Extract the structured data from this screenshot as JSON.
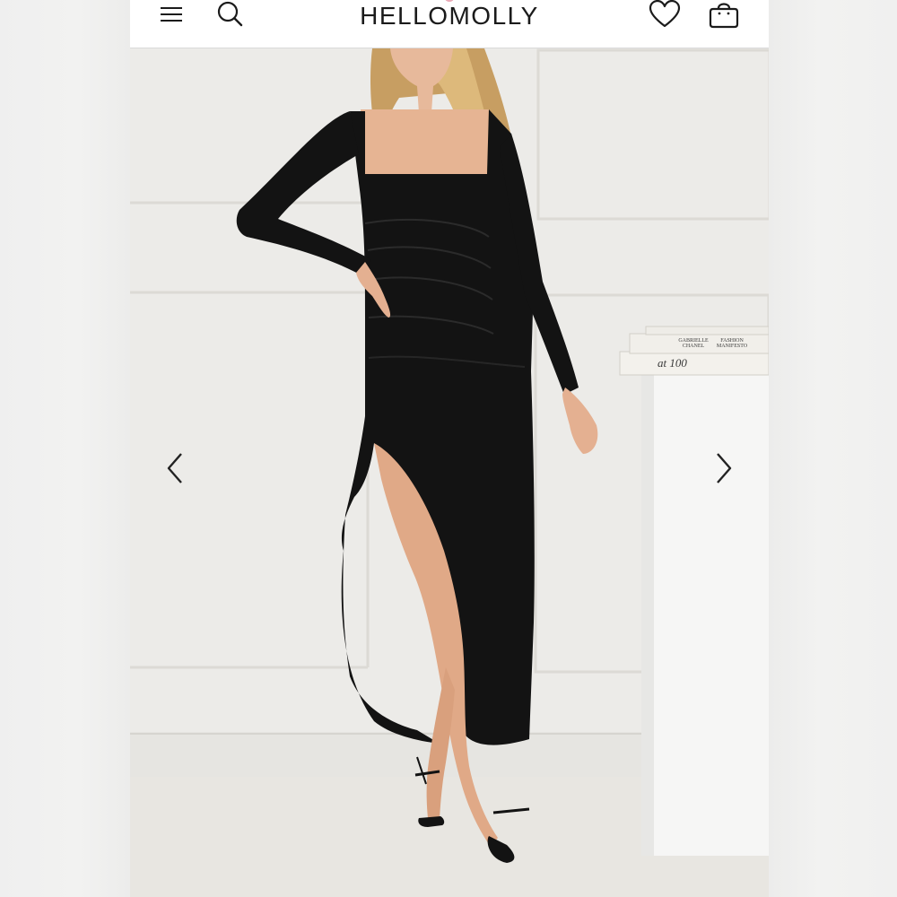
{
  "header": {
    "brand": "HELLOMOLLY",
    "menu_icon": "hamburger-menu-icon",
    "search_icon": "search-icon",
    "wishlist_icon": "heart-icon",
    "cart_icon": "shopping-bag-icon"
  },
  "carousel": {
    "prev_icon": "chevron-left-icon",
    "next_icon": "chevron-right-icon"
  },
  "books": {
    "top_left_line1": "GABRIELLE",
    "top_left_line2": "CHANEL",
    "top_right_line1": "FASHION",
    "top_right_line2": "MANIFESTO",
    "bottom": "at 100"
  },
  "colors": {
    "dress": "#131313",
    "wall": "#ecebe8",
    "header_bg": "#ffffff",
    "logo_accent": "#e9a9b6"
  }
}
